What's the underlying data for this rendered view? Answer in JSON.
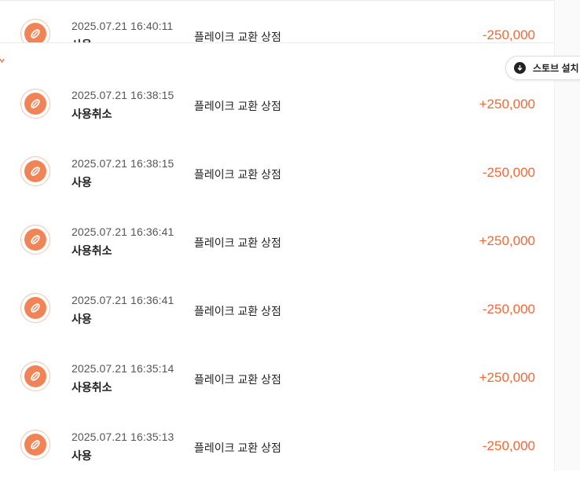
{
  "colors": {
    "accent": "#f0693a",
    "icon_fill": "#f08457",
    "divider": "#ececec"
  },
  "icons": {
    "row_icon": "coupon-leaf-icon",
    "install_icon": "download-arrow-icon"
  },
  "install_button": {
    "label": "스토브 설치"
  },
  "transactions": [
    {
      "datetime": "2025.07.21 16:40:11",
      "type": "사용",
      "place": "플레이크 교환 상점",
      "amount": "-250,000"
    },
    {
      "datetime": "2025.07.21 16:38:15",
      "type": "사용취소",
      "place": "플레이크 교환 상점",
      "amount": "+250,000"
    },
    {
      "datetime": "2025.07.21 16:38:15",
      "type": "사용",
      "place": "플레이크 교환 상점",
      "amount": "-250,000"
    },
    {
      "datetime": "2025.07.21 16:36:41",
      "type": "사용취소",
      "place": "플레이크 교환 상점",
      "amount": "+250,000"
    },
    {
      "datetime": "2025.07.21 16:36:41",
      "type": "사용",
      "place": "플레이크 교환 상점",
      "amount": "-250,000"
    },
    {
      "datetime": "2025.07.21 16:35:14",
      "type": "사용취소",
      "place": "플레이크 교환 상점",
      "amount": "+250,000"
    },
    {
      "datetime": "2025.07.21 16:35:13",
      "type": "사용",
      "place": "플레이크 교환 상점",
      "amount": "-250,000"
    }
  ]
}
